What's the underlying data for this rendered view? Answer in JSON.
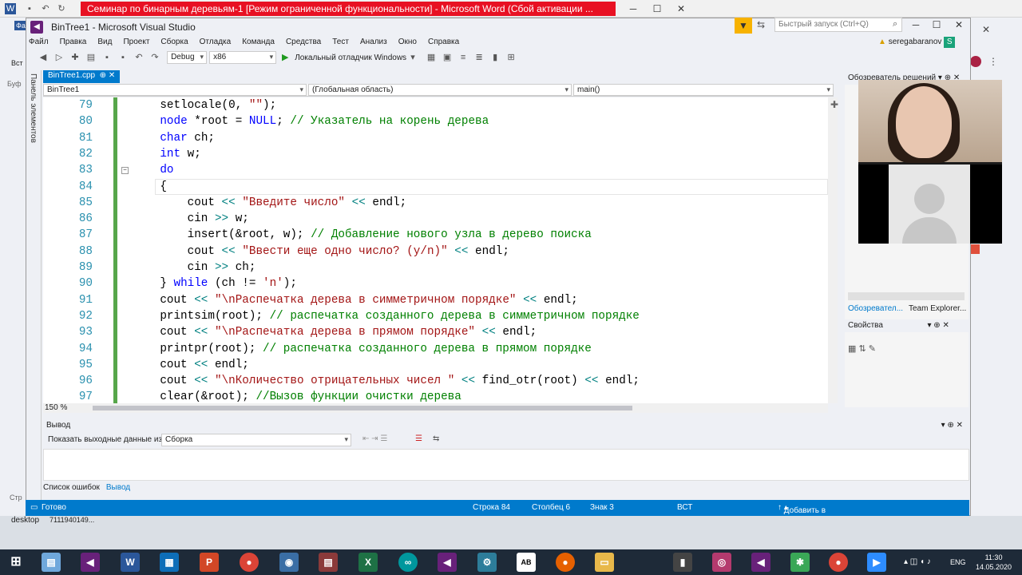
{
  "word": {
    "title": "Семинар по бинарным деревьям-1 [Режим ограниченной функциональности] - Microsoft Word (Сбой активации ..."
  },
  "vs": {
    "title": "BinTree1 - Microsoft Visual Studio",
    "quick_launch_placeholder": "Быстрый запуск (Ctrl+Q)",
    "user": "seregabaranov",
    "user_initial": "S"
  },
  "menu": [
    "Файл",
    "Правка",
    "Вид",
    "Проект",
    "Сборка",
    "Отладка",
    "Команда",
    "Средства",
    "Тест",
    "Анализ",
    "Окно",
    "Справка"
  ],
  "toolbar": {
    "config": "Debug",
    "platform": "x86",
    "debugger": "Локальный отладчик Windows"
  },
  "left_strip": "Панель элементов",
  "tab": {
    "label": "BinTree1.cpp",
    "pin": "⊕",
    "close": "✕"
  },
  "navbar": {
    "project": "BinTree1",
    "scope": "(Глобальная область)",
    "member": "main()"
  },
  "editor": {
    "zoom": "150 %",
    "lines": [
      {
        "n": "79",
        "c": "    setlocale(0, \"\");"
      },
      {
        "n": "80",
        "c": "    node *root = NULL; // Указатель на корень дерева"
      },
      {
        "n": "81",
        "c": "    char ch;"
      },
      {
        "n": "82",
        "c": "    int w;"
      },
      {
        "n": "83",
        "c": "    do"
      },
      {
        "n": "84",
        "c": "    {"
      },
      {
        "n": "85",
        "c": "        cout << \"Введите число\" << endl;"
      },
      {
        "n": "86",
        "c": "        cin >> w;"
      },
      {
        "n": "87",
        "c": "        insert(&root, w); // Добавление нового узла в дерево поиска"
      },
      {
        "n": "88",
        "c": "        cout << \"Ввести еще одно число? (y/n)\" << endl;"
      },
      {
        "n": "89",
        "c": "        cin >> ch;"
      },
      {
        "n": "90",
        "c": "    } while (ch != 'n');"
      },
      {
        "n": "91",
        "c": "    cout << \"\\nРаспечатка дерева в симметричном порядке\" << endl;"
      },
      {
        "n": "92",
        "c": "    printsim(root); // распечатка созданного дерева в симметричном порядке"
      },
      {
        "n": "93",
        "c": "    cout << \"\\nРаспечатка дерева в прямом порядке\" << endl;"
      },
      {
        "n": "94",
        "c": "    printpr(root); // распечатка созданного дерева в прямом порядке"
      },
      {
        "n": "95",
        "c": "    cout << endl;"
      },
      {
        "n": "96",
        "c": "    cout << \"\\nКоличество отрицательных чисел \" << find_otr(root) << endl;"
      },
      {
        "n": "97",
        "c": "    clear(&root); //Вызов функции очистки дерева"
      }
    ]
  },
  "solution_explorer": {
    "title": "Обозреватель решений",
    "tab1": "Обозревател...",
    "tab2": "Team Explorer..."
  },
  "properties": {
    "title": "Свойства"
  },
  "output": {
    "title": "Вывод",
    "show_from_label": "Показать выходные данные из:",
    "show_from_value": "Сборка"
  },
  "bottom_tabs": [
    "Список ошибок",
    "Вывод"
  ],
  "status": {
    "ready": "Готово",
    "line": "Строка 84",
    "col": "Столбец 6",
    "char": "Знак 3",
    "mode": "ВСТ",
    "vcs": "Добавить в систему управления версиями"
  },
  "desktop": {
    "label": "desktop",
    "num": "7111940149..."
  },
  "behind_fragments": [
    "Фа",
    "Вст",
    "Буф",
    "Стр"
  ],
  "clock": {
    "time": "11:30",
    "date": "14.05.2020",
    "lang": "ENG"
  },
  "colors": {
    "accent": "#007acc",
    "word_red": "#e81123",
    "changebar": "#57a64a"
  }
}
